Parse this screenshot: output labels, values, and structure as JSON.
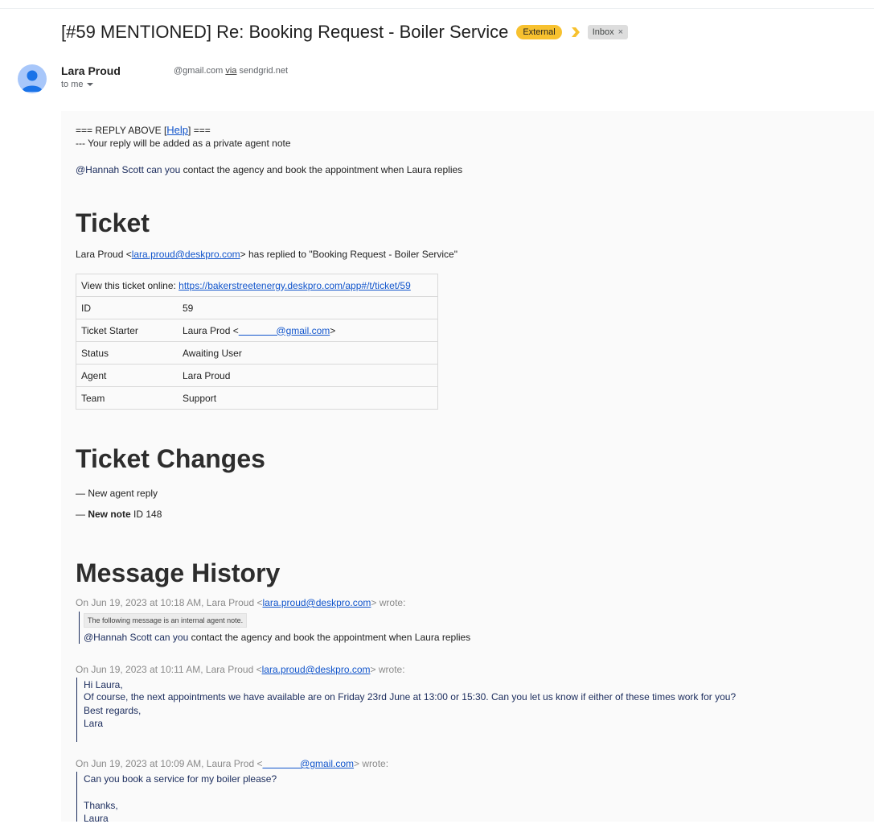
{
  "header": {
    "subject": "[#59 MENTIONED] Re: Booking Request - Boiler Service",
    "external_label": "External",
    "inbox_label": "Inbox",
    "inbox_close": "×"
  },
  "sender": {
    "name": "Lara Proud",
    "email_suffix": "@gmail.com",
    "via_label": "via",
    "via_domain": "sendgrid.net",
    "to_label": "to me"
  },
  "message": {
    "reply_above_prefix": "===   REPLY ABOVE [",
    "help_link": "Help",
    "reply_above_suffix": "] ===",
    "private_note_line": "--- Your reply will be added as a private agent note",
    "mention_bold": "@Hannah Scott can you",
    "mention_rest": " contact the agency and book the appointment when Laura replies"
  },
  "ticket": {
    "heading": "Ticket",
    "replied_prefix": "Lara Proud <",
    "replied_email": "lara.proud@deskpro.com",
    "replied_suffix": "> has replied to \"Booking Request - Boiler Service\"",
    "view_online_label": "View this ticket online: ",
    "view_online_url": "https://bakerstreetenergy.deskpro.com/app#/t/ticket/59",
    "rows": [
      {
        "label": "ID",
        "value": "59"
      },
      {
        "label": "Ticket Starter",
        "value": "Laura Prod <",
        "link": "              @gmail.com",
        "after": ">"
      },
      {
        "label": "Status",
        "value": "Awaiting User"
      },
      {
        "label": "Agent",
        "value": "Lara Proud"
      },
      {
        "label": "Team",
        "value": "Support"
      }
    ]
  },
  "changes": {
    "heading": "Ticket Changes",
    "item1": "— New agent reply",
    "item2_dash": "— ",
    "item2_bold": "New note",
    "item2_rest": " ID 148"
  },
  "history": {
    "heading": "Message History",
    "m1_prefix": "On Jun 19, 2023 at 10:18 AM, Lara Proud <",
    "m1_email": "lara.proud@deskpro.com",
    "m1_suffix": "> wrote:",
    "m1_note": "The following message is an internal agent note.",
    "m1_bold": "@Hannah Scott can you",
    "m1_rest": " contact the agency and book the appointment when Laura replies",
    "m2_prefix": "On Jun 19, 2023 at 10:11 AM, Lara Proud <",
    "m2_email": "lara.proud@deskpro.com",
    "m2_suffix": "> wrote:",
    "m2_l1": "Hi Laura,",
    "m2_l2": "Of course, the next appointments we have available are on Friday 23rd June at 13:00 or 15:30. Can you let us know if either of these times work for you?",
    "m2_l3": "Best regards,",
    "m2_l4": "Lara",
    "m3_prefix": "On Jun 19, 2023 at 10:09 AM, Laura Prod <",
    "m3_email": "              @gmail.com",
    "m3_suffix": "> wrote:",
    "m3_l1": "Can you book a service for my boiler please?",
    "m3_l2": "Thanks,",
    "m3_l3": "Laura"
  }
}
